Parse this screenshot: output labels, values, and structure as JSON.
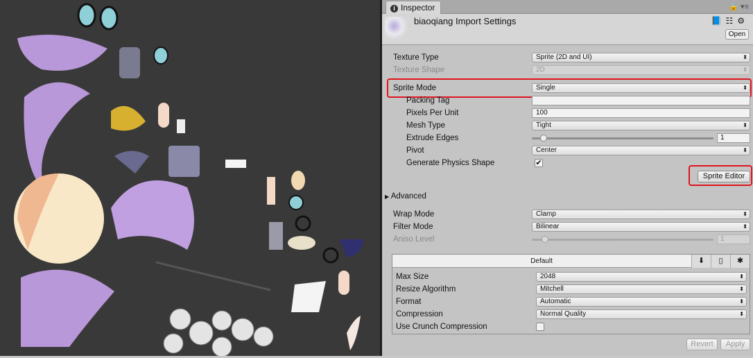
{
  "inspector": {
    "tab": "Inspector",
    "title": "biaoqiang Import Settings",
    "open": "Open"
  },
  "settings": {
    "texture_type": {
      "label": "Texture Type",
      "value": "Sprite (2D and UI)"
    },
    "texture_shape": {
      "label": "Texture Shape",
      "value": "2D"
    },
    "sprite_mode": {
      "label": "Sprite Mode",
      "value": "Single"
    },
    "packing_tag": {
      "label": "Packing Tag",
      "value": ""
    },
    "pixels_per_unit": {
      "label": "Pixels Per Unit",
      "value": "100"
    },
    "mesh_type": {
      "label": "Mesh Type",
      "value": "Tight"
    },
    "extrude_edges": {
      "label": "Extrude Edges",
      "value": "1"
    },
    "pivot": {
      "label": "Pivot",
      "value": "Center"
    },
    "physics_shape": {
      "label": "Generate Physics Shape",
      "checked": true
    },
    "sprite_editor": "Sprite Editor",
    "advanced": "Advanced",
    "wrap_mode": {
      "label": "Wrap Mode",
      "value": "Clamp"
    },
    "filter_mode": {
      "label": "Filter Mode",
      "value": "Bilinear"
    },
    "aniso_level": {
      "label": "Aniso Level",
      "value": "1"
    }
  },
  "platform": {
    "tab": "Default",
    "max_size": {
      "label": "Max Size",
      "value": "2048"
    },
    "resize": {
      "label": "Resize Algorithm",
      "value": "Mitchell"
    },
    "format": {
      "label": "Format",
      "value": "Automatic"
    },
    "compression": {
      "label": "Compression",
      "value": "Normal Quality"
    },
    "crunch": {
      "label": "Use Crunch Compression",
      "checked": false
    }
  },
  "footer": {
    "revert": "Revert",
    "apply": "Apply"
  },
  "colors": {
    "highlight": "#e0141e",
    "canvas": "#393939"
  }
}
